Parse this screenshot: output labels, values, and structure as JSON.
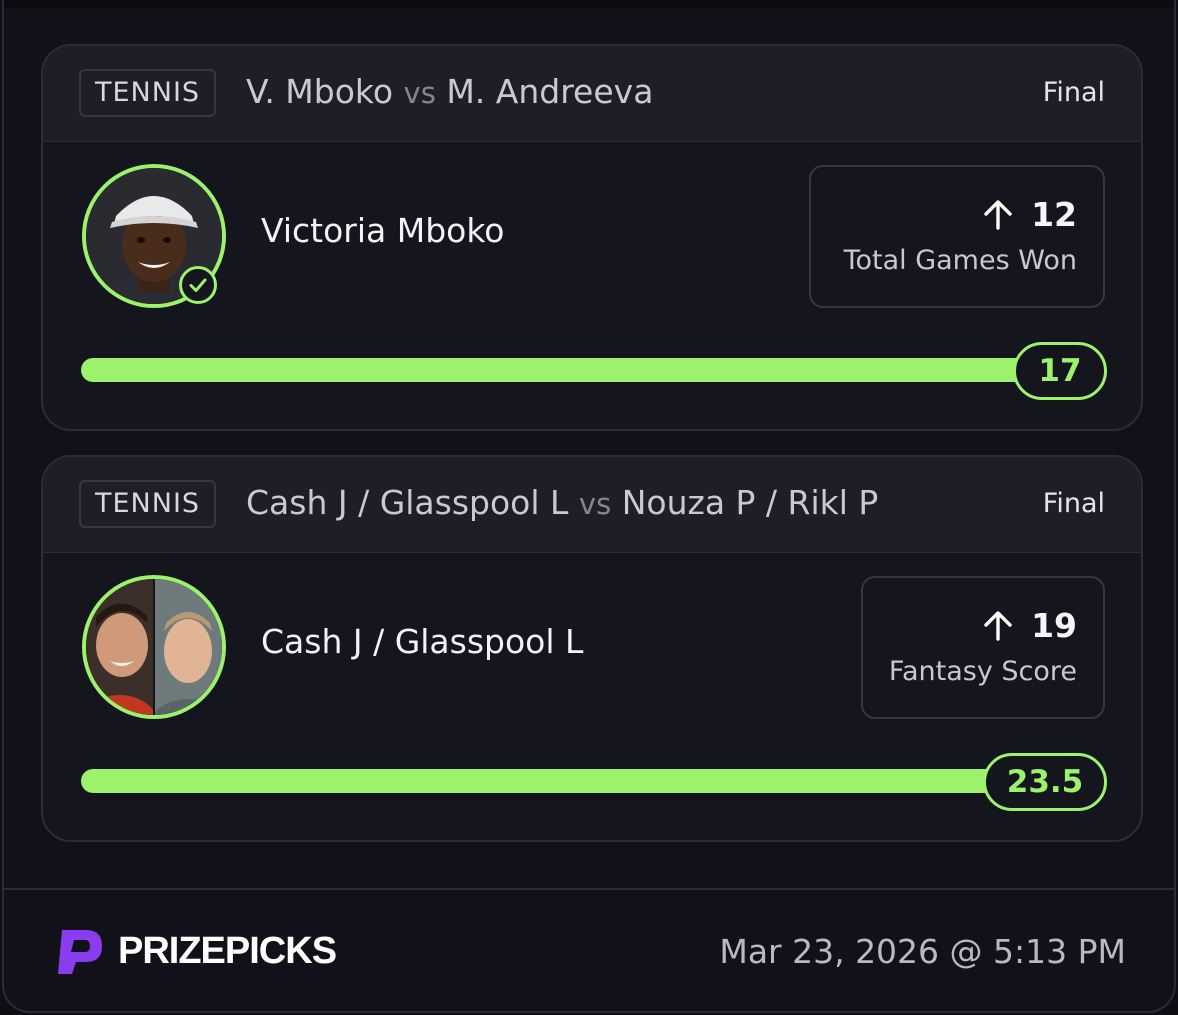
{
  "accent_color": "#9cf26b",
  "picks": [
    {
      "sport": "TENNIS",
      "team_a": "V. Mboko",
      "vs": "vs",
      "team_b": "M. Andreeva",
      "status": "Final",
      "player": "Victoria Mboko",
      "direction_icon": "arrow-up-icon",
      "line": "12",
      "stat": "Total Games Won",
      "actual": "17",
      "result_icon": "check-circle-icon"
    },
    {
      "sport": "TENNIS",
      "team_a": "Cash J / Glasspool L",
      "vs": "vs",
      "team_b": "Nouza P / Rikl P",
      "status": "Final",
      "player": "Cash J / Glasspool L",
      "direction_icon": "arrow-up-icon",
      "line": "19",
      "stat": "Fantasy Score",
      "actual": "23.5"
    }
  ],
  "footer": {
    "brand": "PRIZEPICKS",
    "timestamp": "Mar 23, 2026 @ 5:13 PM"
  }
}
